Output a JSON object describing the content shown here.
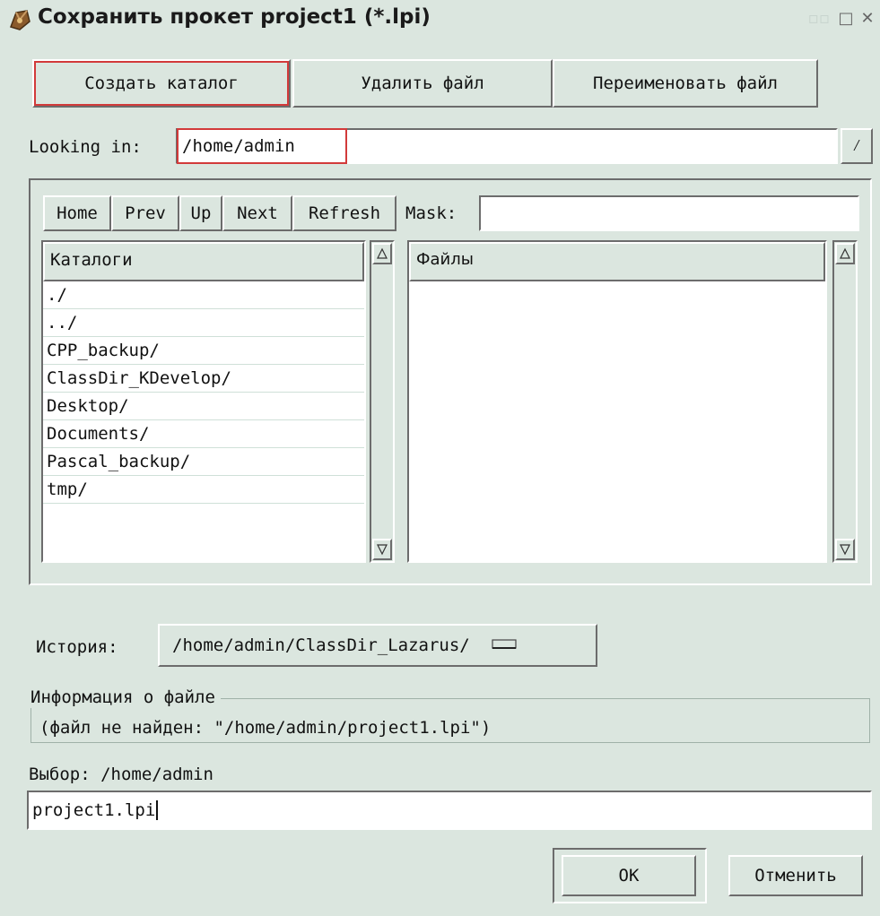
{
  "window": {
    "title": "Сохранить прокет project1 (*.lpi)"
  },
  "toolbar": {
    "create_dir": "Создать каталог",
    "delete_file": "Удалить файл",
    "rename_file": "Переименовать файл"
  },
  "looking_in": {
    "label": "Looking in:",
    "value": "/home/admin"
  },
  "nav": {
    "home": "Home",
    "prev": "Prev",
    "up": "Up",
    "next": "Next",
    "refresh": "Refresh",
    "mask_label": "Mask:",
    "mask_value": ""
  },
  "dirs": {
    "header": "Каталоги",
    "items": [
      "./",
      "../",
      "CPP_backup/",
      "ClassDir_KDevelop/",
      "Desktop/",
      "Documents/",
      "Pascal_backup/",
      "tmp/"
    ]
  },
  "files": {
    "header": "Файлы",
    "items": []
  },
  "history": {
    "label": "История:",
    "value": "/home/admin/ClassDir_Lazarus/"
  },
  "fileinfo": {
    "legend": "Информация о файле",
    "text": "(файл не найден: \"/home/admin/project1.lpi\")"
  },
  "selection": {
    "label": "Выбор: /home/admin",
    "filename": "project1.lpi"
  },
  "buttons": {
    "ok": "OK",
    "cancel": "Отменить"
  },
  "colors": {
    "window_bg": "#dbe6df",
    "focus_red": "#d23a3a",
    "field_bg": "#ffffff"
  }
}
